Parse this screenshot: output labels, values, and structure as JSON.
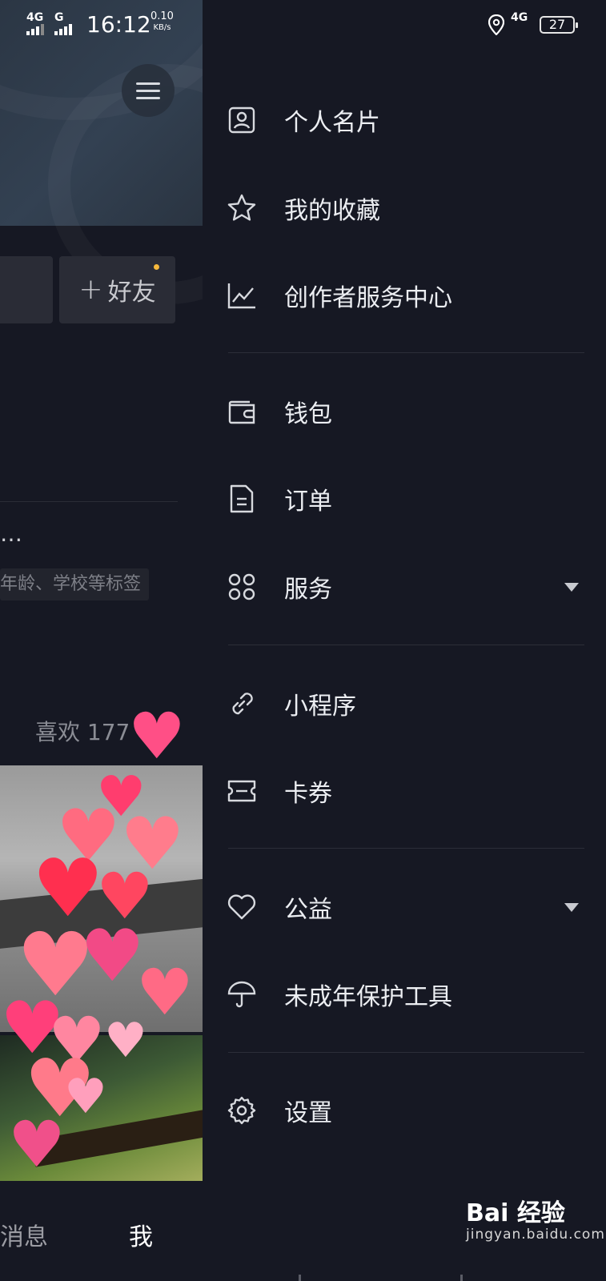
{
  "status_bar": {
    "network_left_1": "4G",
    "network_left_2": "G",
    "time": "16:12",
    "speed_value": "0.10",
    "speed_unit": "KB/s",
    "network_right": "4G",
    "battery": "27"
  },
  "profile_background": {
    "add_friend_label": "好友",
    "bio_ellipsis": "…",
    "bio_tags_hint": "年龄、学校等标签",
    "likes_label": "喜欢 177",
    "tabs": {
      "message": "消息",
      "me": "我"
    }
  },
  "drawer": {
    "items": [
      {
        "label": "个人名片",
        "icon": "profile-card-icon"
      },
      {
        "label": "我的收藏",
        "icon": "star-icon"
      },
      {
        "label": "创作者服务中心",
        "icon": "chart-icon"
      },
      {
        "label": "钱包",
        "icon": "wallet-icon"
      },
      {
        "label": "订单",
        "icon": "order-document-icon"
      },
      {
        "label": "服务",
        "icon": "apps-grid-icon",
        "expandable": true
      },
      {
        "label": "小程序",
        "icon": "mini-program-link-icon"
      },
      {
        "label": "卡券",
        "icon": "ticket-icon"
      },
      {
        "label": "公益",
        "icon": "heart-icon",
        "expandable": true
      },
      {
        "label": "未成年保护工具",
        "icon": "umbrella-icon"
      },
      {
        "label": "设置",
        "icon": "gear-icon"
      }
    ]
  },
  "watermark": {
    "brand": "Bai 经验",
    "site": "jingyan.baidu.com"
  },
  "colors": {
    "background": "#161823",
    "text": "#eceef2",
    "divider": "#2c2e38",
    "notification_dot": "#f5b83c"
  }
}
